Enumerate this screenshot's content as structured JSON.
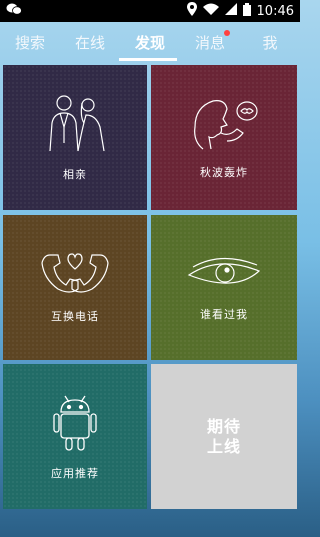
{
  "status_bar": {
    "time": "10:46",
    "icons": [
      "wechat-icon",
      "location-icon",
      "wifi-icon",
      "signal-icon",
      "battery-icon"
    ]
  },
  "tabs": [
    {
      "label": "搜索",
      "active": false
    },
    {
      "label": "在线",
      "active": false
    },
    {
      "label": "发现",
      "active": true
    },
    {
      "label": "消息",
      "active": false,
      "badge": true
    },
    {
      "label": "我",
      "active": false
    }
  ],
  "tiles": [
    {
      "label": "相亲",
      "icon": "couple-icon",
      "color": "#312a46"
    },
    {
      "label": "秋波轰炸",
      "icon": "blow-kiss-icon",
      "color": "#6a2536"
    },
    {
      "label": "互换电话",
      "icon": "phone-heart-icon",
      "color": "#5d4523"
    },
    {
      "label": "谁看过我",
      "icon": "eye-icon",
      "color": "#566f2b"
    },
    {
      "label": "应用推荐",
      "icon": "android-icon",
      "color": "#216c67"
    },
    {
      "label": "期待\n上线",
      "icon": "",
      "color": "#d2d2d2"
    }
  ]
}
